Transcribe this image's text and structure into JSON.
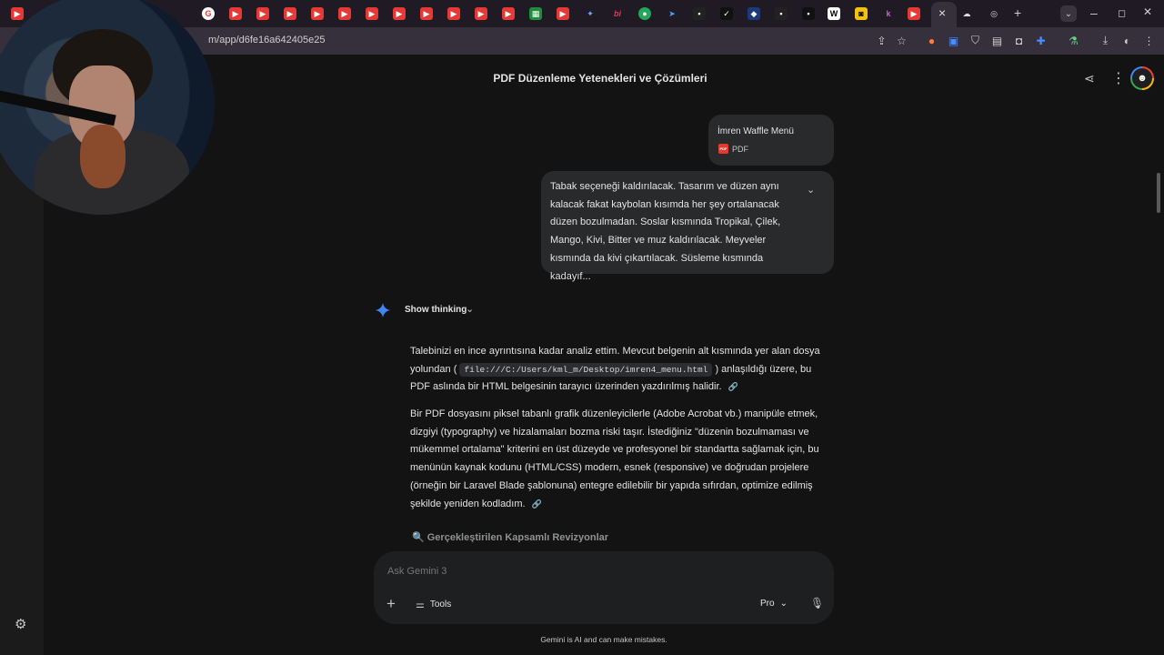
{
  "browser": {
    "url": "m/app/d6fe16a642405e25",
    "tab_close": "×",
    "new_tab": "+",
    "tab_menu": "⌄",
    "window_controls": {
      "minimize": "–",
      "maximize": "◻",
      "close": "✕"
    },
    "favicon_letters": [
      "bi",
      "W",
      "k"
    ]
  },
  "chat": {
    "title": "PDF Düzenleme Yetenekleri ve Çözümleri",
    "attachment": {
      "name": "İmren Waffle Menü",
      "type": "PDF",
      "badge": "PDF"
    },
    "user_message": "Tabak seçeneği kaldırılacak. Tasarım ve düzen aynı kalacak fakat kaybolan kısımda her şey ortalanacak düzen bozulmadan. Soslar kısmında Tropikal, Çilek, Mango, Kivi, Bitter ve muz kaldırılacak. Meyveler kısmında da kivi çıkartılacak. Süsleme kısmında kadayıf...",
    "show_thinking": "Show thinking",
    "response": {
      "p1_before": "Talebinizi en ince ayrıntısına kadar analiz ettim. Mevcut belgenin alt kısmında yer alan dosya yolundan (",
      "p1_code": "file:///C:/Users/kml_m/Desktop/imren4_menu.html",
      "p1_after": ") anlaşıldığı üzere, bu PDF aslında bir HTML belgesinin tarayıcı üzerinden yazdırılmış halidir.",
      "p2": "Bir PDF dosyasını piksel tabanlı grafik düzenleyicilerle (Adobe Acrobat vb.) manipüle etmek, dizgiyi (typography) ve hizalamaları bozma riski taşır. İstediğiniz \"düzenin bozulmaması ve mükemmel ortalama\" kriterini en üst düzeyde ve profesyonel bir standartta sağlamak için, bu menünün kaynak kodunu (HTML/CSS) modern, esnek (responsive) ve doğrudan projelere (örneğin bir Laravel Blade şablonuna) entegre edilebilir bir yapıda sıfırdan, optimize edilmiş şekilde yeniden kodladım.",
      "section_heading": "🔍 Gerçekleştirilen Kapsamlı Revizyonlar"
    }
  },
  "input": {
    "placeholder": "Ask Gemini 3",
    "tools_label": "Tools",
    "model_label": "Pro",
    "disclaimer": "Gemini is AI and can make mistakes."
  },
  "colors": {
    "background": "#131314",
    "bubble": "#282a2c",
    "input": "#1e1f20",
    "accent_spark": "#4285f4"
  }
}
